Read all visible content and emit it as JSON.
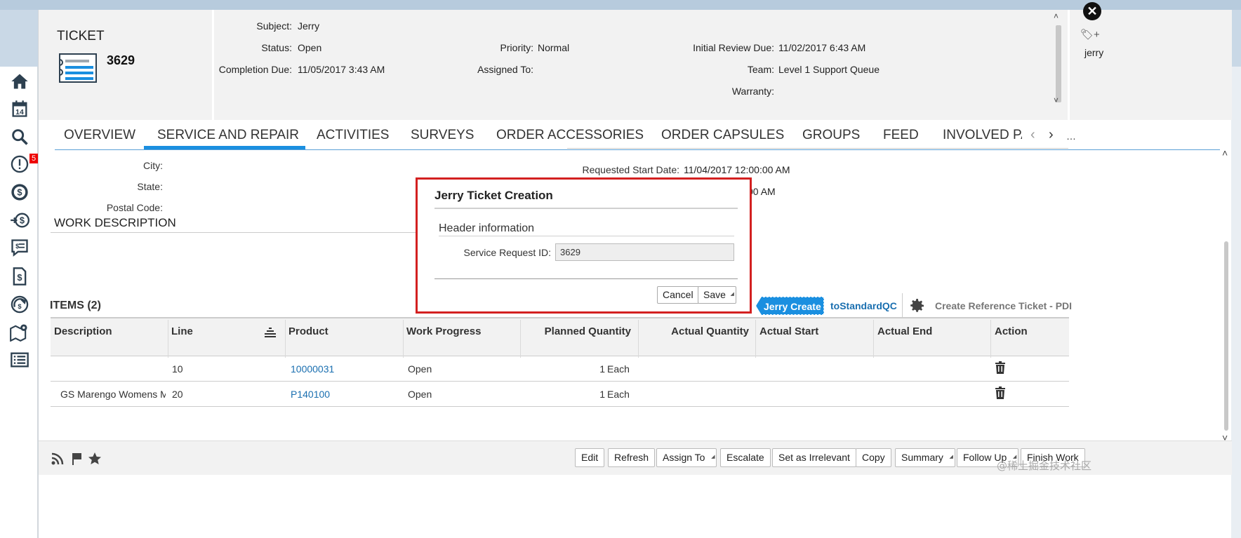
{
  "header": {
    "object_type": "TICKET",
    "ticket_id": "3629",
    "fields": {
      "subject_label": "Subject:",
      "subject": "Jerry",
      "status_label": "Status:",
      "status": "Open",
      "completion_due_label": "Completion Due:",
      "completion_due": "11/05/2017 3:43 AM",
      "priority_label": "Priority:",
      "priority": "Normal",
      "assigned_to_label": "Assigned To:",
      "assigned_to": "",
      "initial_review_due_label": "Initial Review Due:",
      "initial_review_due": "11/02/2017 6:43 AM",
      "team_label": "Team:",
      "team": "Level 1 Support Queue",
      "warranty_label": "Warranty:",
      "warranty": ""
    },
    "tags": [
      "jerry"
    ]
  },
  "tabs": [
    {
      "label": "OVERVIEW",
      "active": false
    },
    {
      "label": "SERVICE AND REPAIR",
      "active": true
    },
    {
      "label": "ACTIVITIES",
      "active": false
    },
    {
      "label": "SURVEYS",
      "active": false
    },
    {
      "label": "ORDER ACCESSORIES",
      "active": false
    },
    {
      "label": "ORDER CAPSULES",
      "active": false
    },
    {
      "label": "GROUPS",
      "active": false
    },
    {
      "label": "FEED",
      "active": false
    },
    {
      "label": "INVOLVED PA",
      "active": false
    }
  ],
  "address": {
    "city_label": "City:",
    "state_label": "State:",
    "postal_label": "Postal Code:"
  },
  "schedule": {
    "requested_start_label": "Requested Start Date:",
    "requested_start": "11/04/2017 12:00:00 AM",
    "second_value_partial": "00 AM"
  },
  "work_description_title": "WORK DESCRIPTION",
  "items": {
    "title": "ITEMS (2)",
    "actions": {
      "jerry_create": "Jerry Create",
      "to_standard_qc": "toStandardQC",
      "create_reference": "Create Reference Ticket - PDI"
    },
    "columns": [
      "Description",
      "Line",
      "Product",
      "Work Progress",
      "Planned Quantity",
      "Actual Quantity",
      "Actual Start",
      "Actual End",
      "Action"
    ],
    "rows": [
      {
        "description": "",
        "line": "10",
        "product": "10000031",
        "work_progress": "Open",
        "planned_qty": "1",
        "planned_unit": "Each",
        "actual_qty": "",
        "actual_start": "",
        "actual_end": ""
      },
      {
        "description": "GS Marengo Womens M..",
        "line": "20",
        "product": "P140100",
        "work_progress": "Open",
        "planned_qty": "1",
        "planned_unit": "Each",
        "actual_qty": "",
        "actual_start": "",
        "actual_end": ""
      }
    ]
  },
  "footer": {
    "buttons": [
      {
        "label": "Edit",
        "menu": false
      },
      {
        "label": "Refresh",
        "menu": false
      },
      {
        "label": "Assign To",
        "menu": true
      },
      {
        "label": "Escalate",
        "menu": false
      },
      {
        "label": "Set as Irrelevant",
        "menu": false
      },
      {
        "label": "Copy",
        "menu": false
      },
      {
        "label": "Summary",
        "menu": true
      },
      {
        "label": "Follow Up",
        "menu": true
      },
      {
        "label": "Finish Work",
        "menu": false
      }
    ]
  },
  "dialog": {
    "title": "Jerry Ticket Creation",
    "section": "Header information",
    "service_request_label": "Service Request ID:",
    "service_request_value": "3629",
    "cancel": "Cancel",
    "save": "Save"
  },
  "sidebar": {
    "badge": "5",
    "icons": [
      "home-icon",
      "calendar-icon",
      "search-icon",
      "alert-icon",
      "dollar-icon",
      "dollar-transfer-icon",
      "quote-chat-icon",
      "invoice-icon",
      "cycle-dollar-icon",
      "map-pin-icon",
      "list-icon"
    ],
    "calendar_day": "14"
  },
  "watermark": "@稀土掘金技术社区",
  "colors": {
    "accent": "#1a8fe0",
    "link": "#1a6fb0",
    "dialog_border": "#d32020",
    "nav_icon": "#2d4050"
  }
}
